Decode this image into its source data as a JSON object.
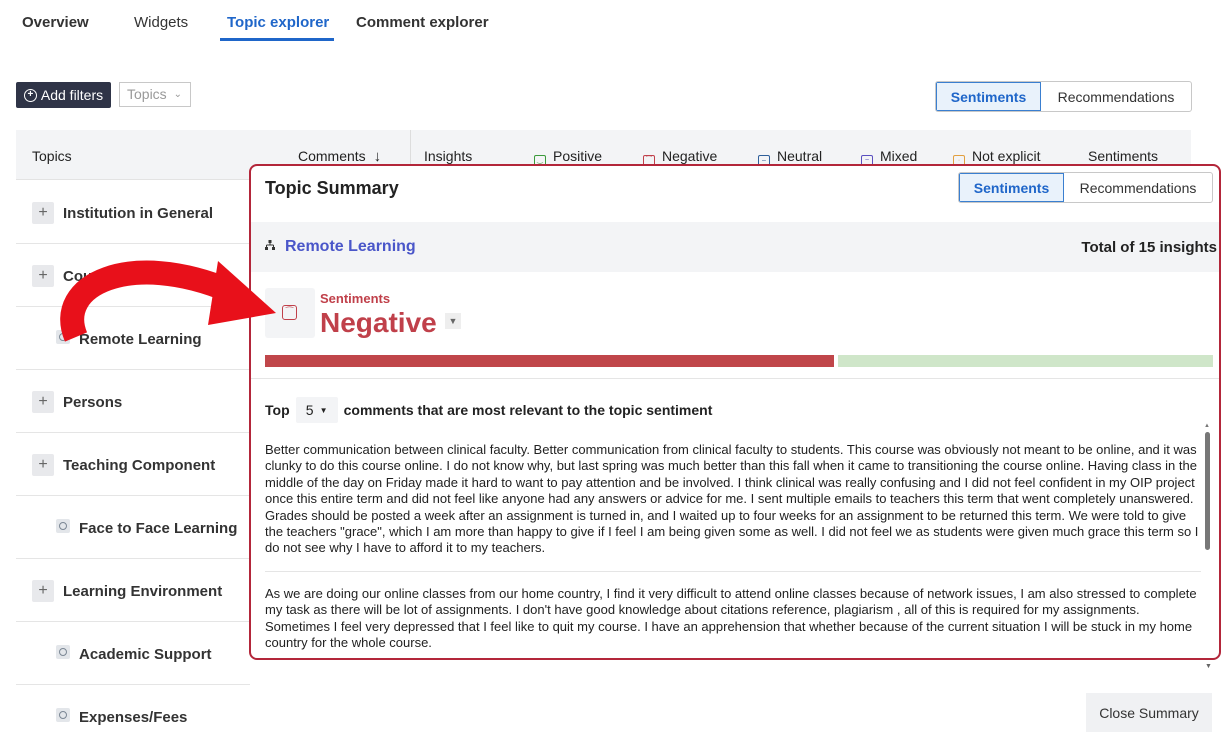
{
  "nav": {
    "tabs": [
      {
        "label": "Overview",
        "active": false
      },
      {
        "label": "Widgets",
        "active": false
      },
      {
        "label": "Topic explorer",
        "active": true
      },
      {
        "label": "Comment explorer",
        "active": false
      }
    ]
  },
  "filters": {
    "add_label": "Add filters",
    "topics_placeholder": "Topics"
  },
  "view_toggle": {
    "sentiments": "Sentiments",
    "recommendations": "Recommendations",
    "selected": "Sentiments"
  },
  "table": {
    "headers": {
      "topics": "Topics",
      "comments": "Comments",
      "sort_icon": "arrow-down-icon",
      "insights": "Insights",
      "positive": "Positive",
      "negative": "Negative",
      "neutral": "Neutral",
      "mixed": "Mixed",
      "not_explicit": "Not explicit",
      "sentiments": "Sentiments"
    },
    "rows": [
      {
        "label": "Institution in General",
        "expandable": true
      },
      {
        "label": "Course Component",
        "expandable": true
      },
      {
        "label": "Remote Learning",
        "expandable": false
      },
      {
        "label": "Persons",
        "expandable": true
      },
      {
        "label": "Teaching Component",
        "expandable": true
      },
      {
        "label": "Face to Face Learning",
        "expandable": false
      },
      {
        "label": "Learning Environment",
        "expandable": true
      },
      {
        "label": "Academic Support",
        "expandable": false
      },
      {
        "label": "Expenses/Fees",
        "expandable": false
      }
    ]
  },
  "summary": {
    "title": "Topic Summary",
    "toggle": {
      "sentiments": "Sentiments",
      "recommendations": "Recommendations",
      "selected": "Sentiments"
    },
    "topic": "Remote Learning",
    "total": "Total of 15 insights",
    "sentiment_label": "Sentiments",
    "sentiment_value": "Negative",
    "bar": {
      "negative_fraction": 0.6,
      "positive_fraction": 0.4
    },
    "top_prefix": "Top",
    "top_count": "5",
    "top_suffix": "comments that are most relevant to the topic sentiment",
    "comments": [
      "Better communication between clinical faculty. Better communication from clinical faculty to students. This course was obviously not meant to be online, and it was clunky to do this course online. I do not know why, but last spring was much better than this fall when it came to transitioning the course online. Having class in the middle of the day on Friday made it hard to want to pay attention and be involved. I think clinical was really confusing and I did not feel confident in my OIP project once this entire term and did not feel like anyone had any answers or advice for me. I sent multiple emails to teachers this term that went completely unanswered. Grades should be posted a week after an assignment is turned in, and I waited up to four weeks for an assignment to be returned this term. We were told to give the teachers \"grace\", which I am more than happy to give if I feel I am being given some as well. I did not feel we as students were given much grace this term so I do not see why I have to afford it to my teachers.",
      "As we are doing our online classes from our home country, I find it very difficult to attend online classes because of network issues, I am also stressed to complete my task as there will be lot of assignments. I don't have good knowledge about citations reference, plagiarism , all of this is required for my assignments. Sometimes I feel very depressed that I feel like to quit my course. I have an apprehension that whether because of the current situation I will be stuck in my home country for the whole course."
    ],
    "close_label": "Close Summary"
  },
  "colors": {
    "accent": "#1f66c9",
    "negative": "#c0464a",
    "positive_bar": "#cfe6c9",
    "highlight_border": "#b3263a",
    "annotation_arrow": "#e8101a"
  }
}
